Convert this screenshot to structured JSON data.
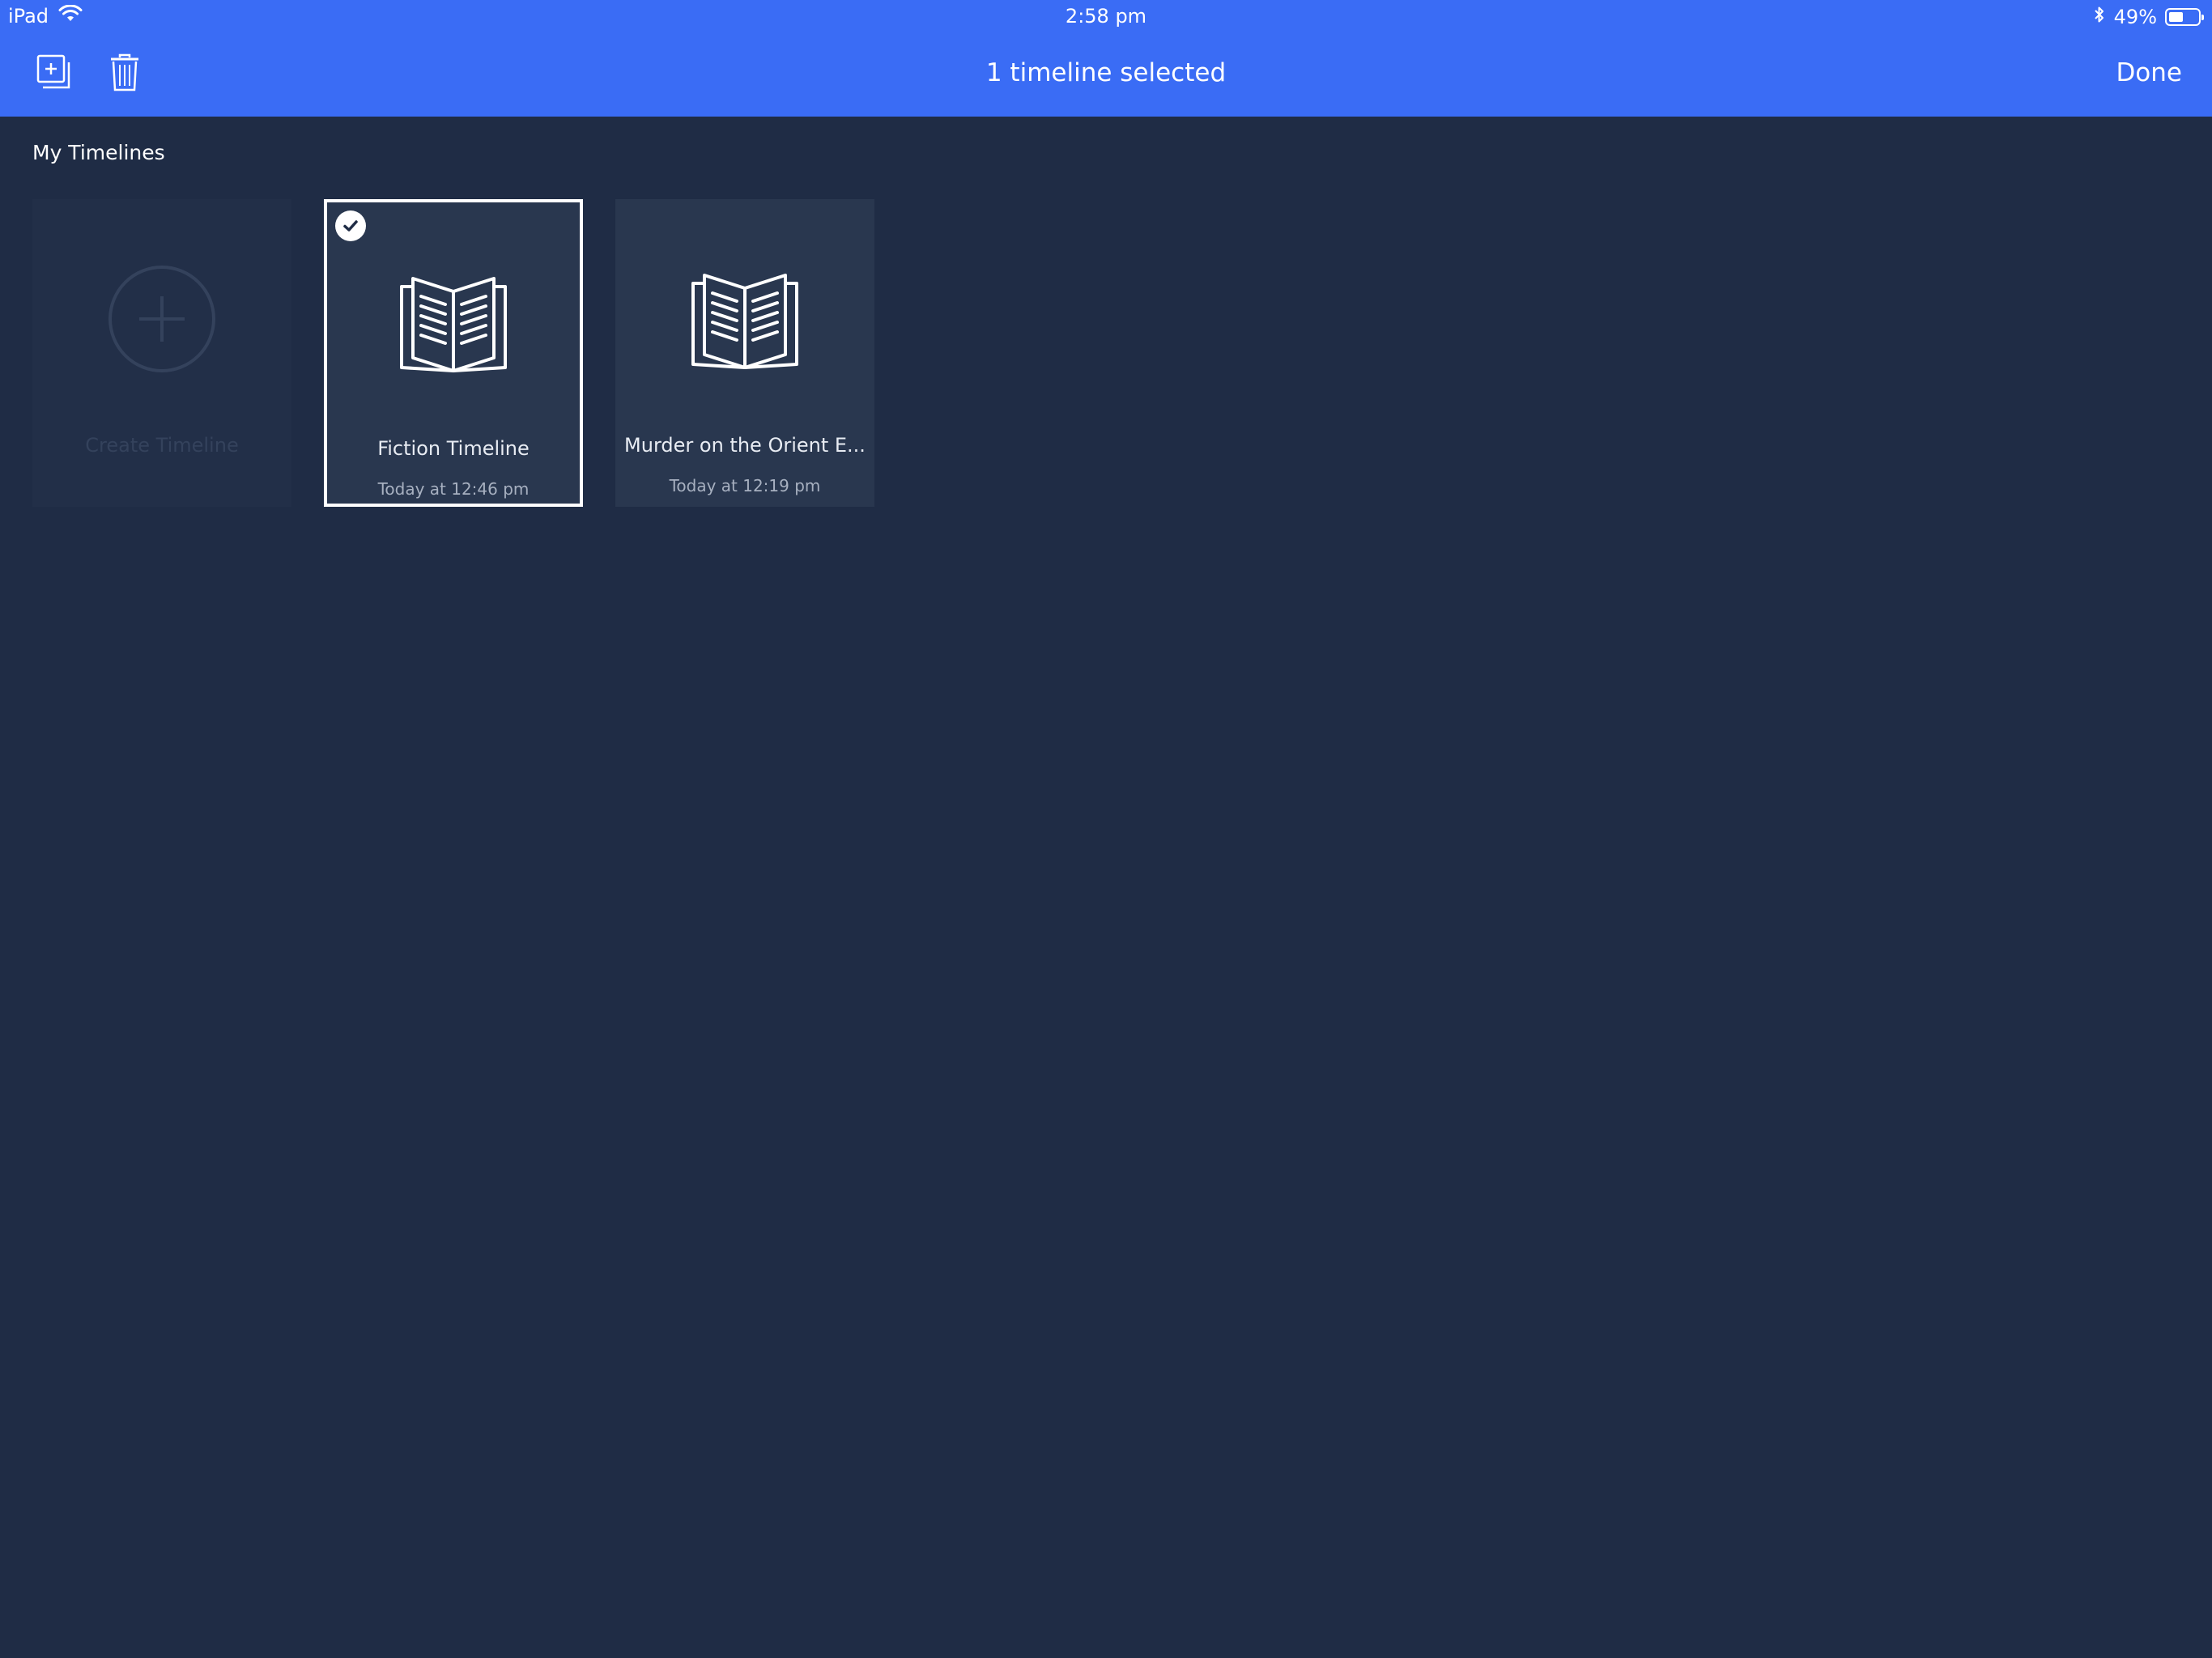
{
  "status_bar": {
    "device": "iPad",
    "time": "2:58 pm",
    "battery_percent": "49%",
    "battery_level": 0.49,
    "icons": [
      "wifi-icon",
      "bluetooth-icon",
      "battery-icon"
    ]
  },
  "nav": {
    "title": "1 timeline selected",
    "done_label": "Done",
    "icons": [
      "duplicate-icon",
      "trash-icon"
    ]
  },
  "section": {
    "title": "My Timelines"
  },
  "cards": [
    {
      "name": "Create Timeline",
      "date": "",
      "selected": false,
      "icon": "plus-circle-icon"
    },
    {
      "name": "Fiction Timeline",
      "date": "Today at 12:46 pm",
      "selected": true,
      "icon": "book-icon"
    },
    {
      "name": "Murder on the Orient E...",
      "date": "Today at 12:19 pm",
      "selected": false,
      "icon": "book-icon"
    }
  ],
  "colors": {
    "accent": "#3a6cf5",
    "background": "#1f2c45",
    "card": "#29374f",
    "card_create": "#222f48"
  }
}
